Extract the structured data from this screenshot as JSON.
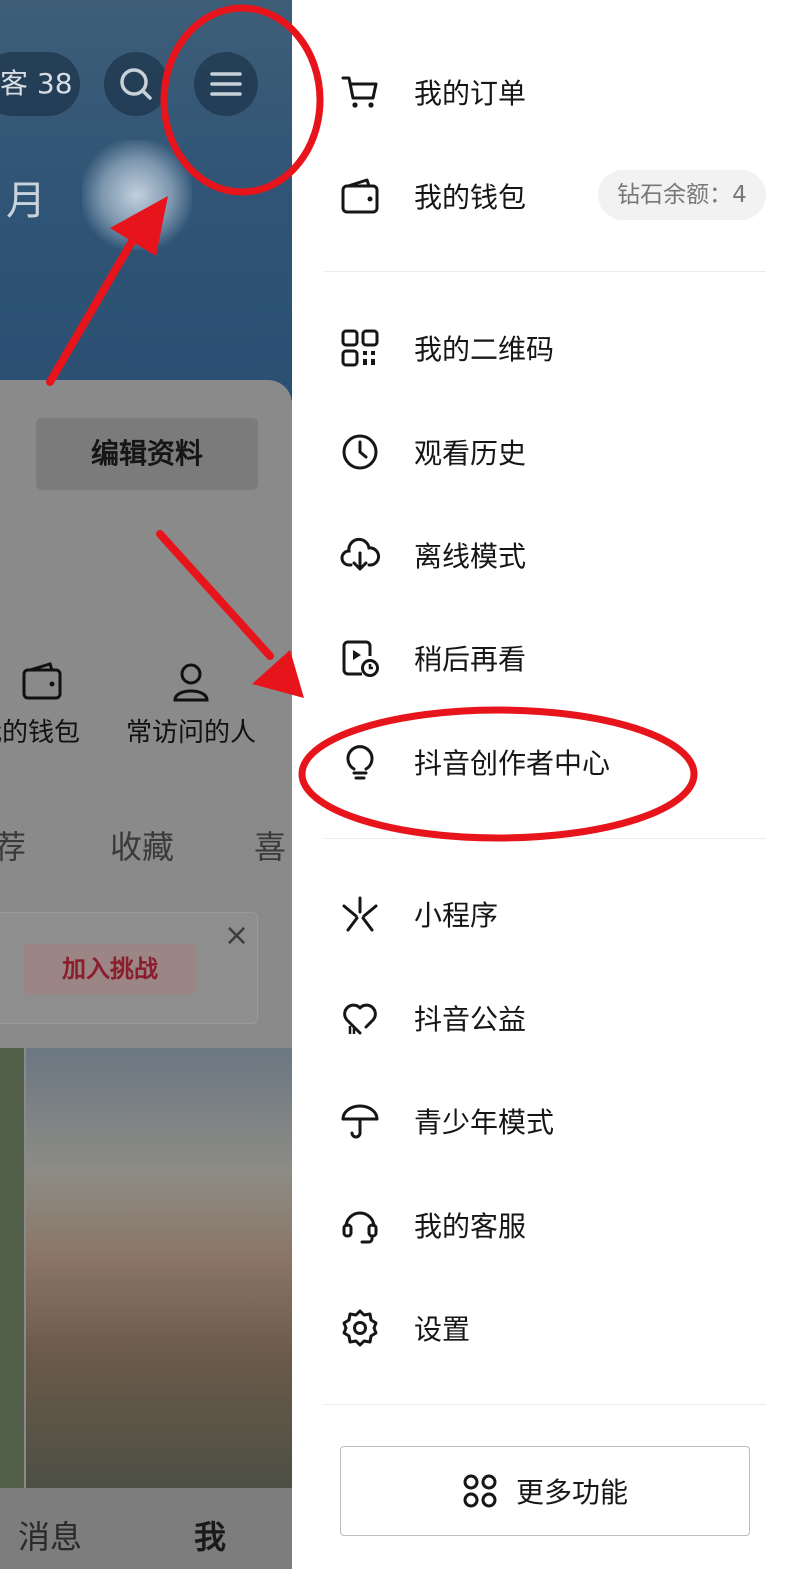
{
  "background_profile": {
    "visitor_count": "客 38",
    "cover_text": "月",
    "edit_profile_label": "编辑资料",
    "shortcuts": [
      {
        "label": "我的钱包",
        "shown": "我的钱包"
      },
      {
        "label": "常访问的人",
        "shown": "常访问的人"
      }
    ],
    "tabs": [
      "荐",
      "收藏",
      "喜"
    ],
    "join_challenge_label": "加入挑战",
    "close_symbol": "×",
    "bottom_nav": [
      "消息",
      "我"
    ]
  },
  "drawer": {
    "group1": [
      {
        "label": "我的订单",
        "icon": "cart-icon"
      },
      {
        "label": "我的钱包",
        "icon": "wallet-icon"
      }
    ],
    "diamond_balance": "钻石余额：4",
    "group2": [
      {
        "label": "我的二维码",
        "icon": "qrcode-icon"
      },
      {
        "label": "观看历史",
        "icon": "clock-icon"
      },
      {
        "label": "离线模式",
        "icon": "cloud-download-icon"
      },
      {
        "label": "稍后再看",
        "icon": "watch-later-icon"
      },
      {
        "label": "抖音创作者中心",
        "icon": "lightbulb-icon"
      }
    ],
    "group3": [
      {
        "label": "小程序",
        "icon": "mini-program-icon"
      },
      {
        "label": "抖音公益",
        "icon": "charity-heart-icon"
      },
      {
        "label": "青少年模式",
        "icon": "umbrella-icon"
      },
      {
        "label": "我的客服",
        "icon": "headset-icon"
      },
      {
        "label": "设置",
        "icon": "gear-icon"
      }
    ],
    "more_features_label": "更多功能"
  },
  "colors": {
    "annotation_red": "#e8141b",
    "text_primary": "#161616",
    "badge_bg": "#f2f2f3"
  }
}
